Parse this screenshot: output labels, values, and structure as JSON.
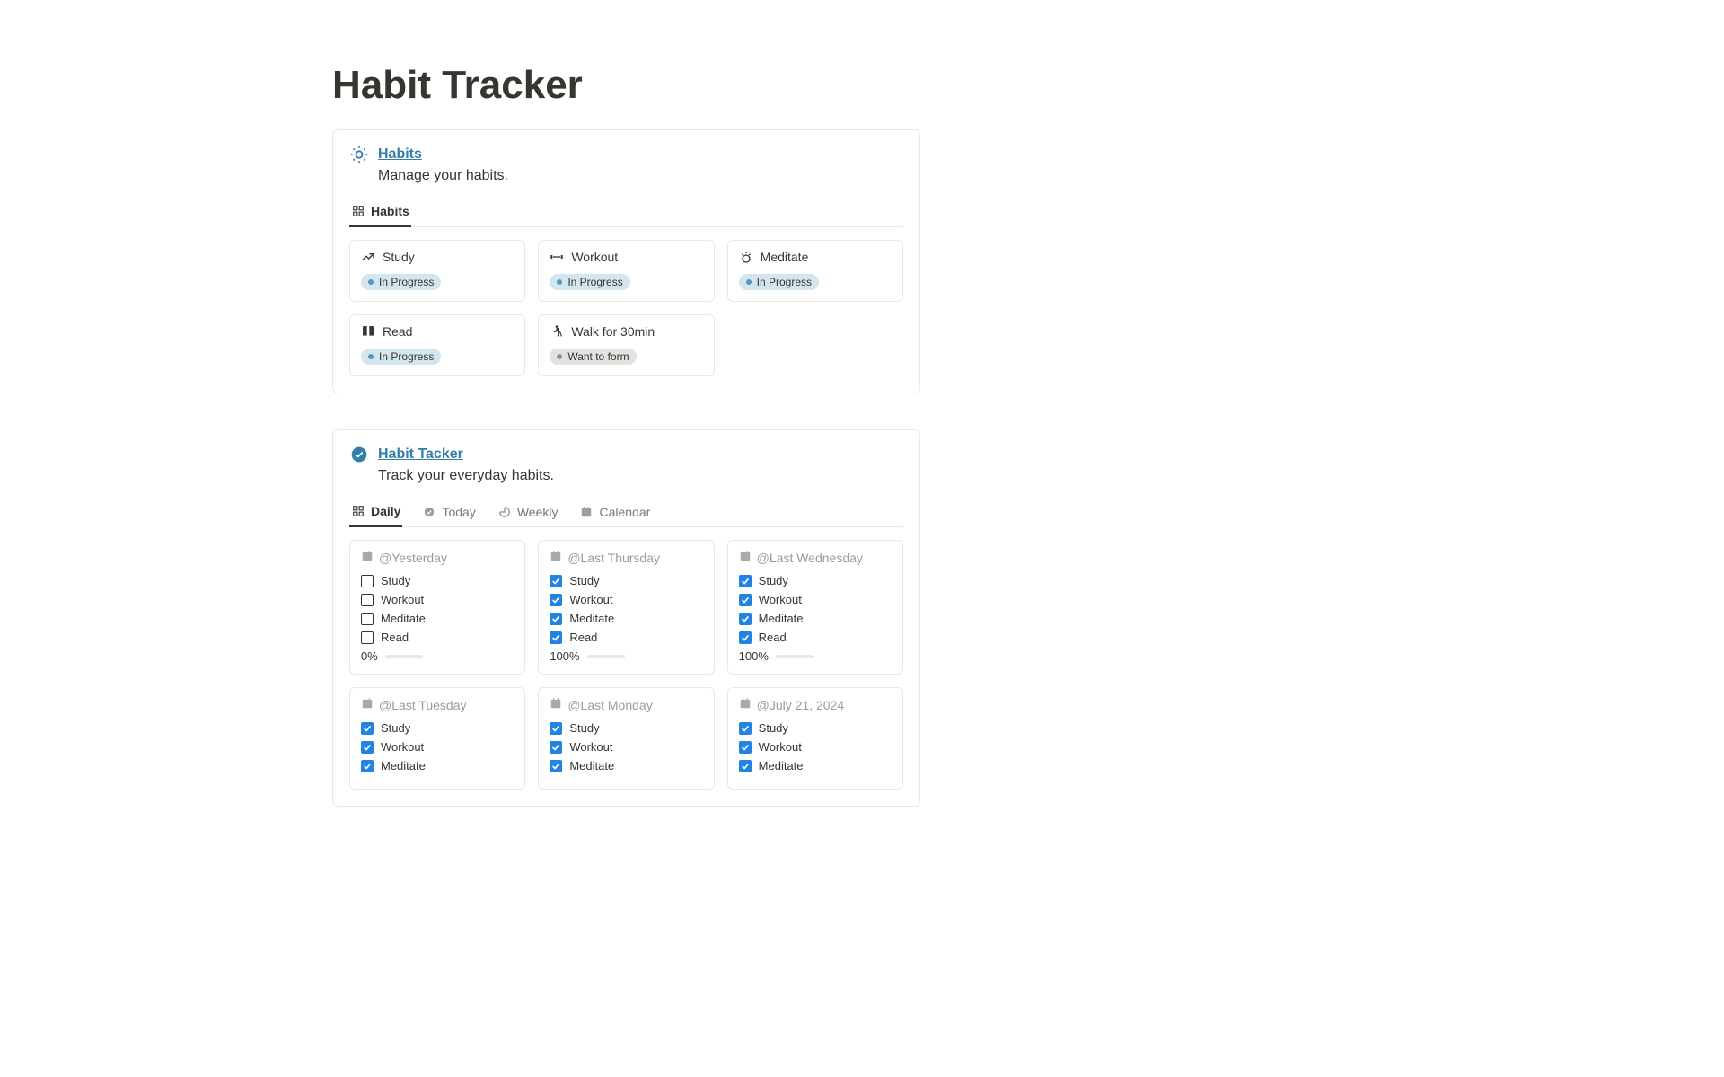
{
  "page": {
    "title": "Habit Tracker"
  },
  "habits_block": {
    "title": "Habits",
    "subtitle": "Manage your habits.",
    "tab_label": "Habits",
    "status_in_progress": "In Progress",
    "status_want": "Want to form",
    "cards": [
      {
        "label": "Study",
        "status": "progress"
      },
      {
        "label": "Workout",
        "status": "progress"
      },
      {
        "label": "Meditate",
        "status": "progress"
      },
      {
        "label": "Read",
        "status": "progress"
      },
      {
        "label": "Walk for 30min",
        "status": "want"
      }
    ]
  },
  "tracker_block": {
    "title": "Habit Tacker",
    "subtitle": "Track your everyday habits.",
    "tabs": [
      {
        "label": "Daily",
        "icon": "grid",
        "active": true
      },
      {
        "label": "Today",
        "icon": "check",
        "active": false
      },
      {
        "label": "Weekly",
        "icon": "chart",
        "active": false
      },
      {
        "label": "Calendar",
        "icon": "calendar",
        "active": false
      }
    ],
    "item_labels": [
      "Study",
      "Workout",
      "Meditate",
      "Read"
    ],
    "days": [
      {
        "title": "@Yesterday",
        "checks": [
          false,
          false,
          false,
          false
        ],
        "percent": "0%",
        "fill": 0
      },
      {
        "title": "@Last Thursday",
        "checks": [
          true,
          true,
          true,
          true
        ],
        "percent": "100%",
        "fill": 100
      },
      {
        "title": "@Last Wednesday",
        "checks": [
          true,
          true,
          true,
          true
        ],
        "percent": "100%",
        "fill": 100
      },
      {
        "title": "@Last Tuesday",
        "checks": [
          true,
          true,
          true
        ],
        "percent": null,
        "fill": null
      },
      {
        "title": "@Last Monday",
        "checks": [
          true,
          true,
          true
        ],
        "percent": null,
        "fill": null
      },
      {
        "title": "@July 21, 2024",
        "checks": [
          true,
          true,
          true
        ],
        "percent": null,
        "fill": null
      }
    ]
  }
}
